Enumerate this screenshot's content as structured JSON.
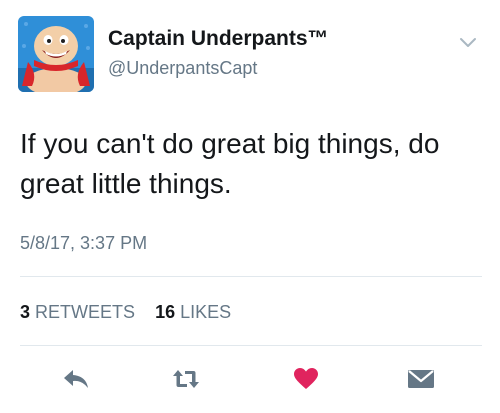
{
  "user": {
    "name": "Captain Underpants™",
    "handle": "@UnderpantsCapt"
  },
  "tweet": {
    "text": "If you can't do great big things, do great little things.",
    "timestamp": "5/8/17, 3:37 PM"
  },
  "stats": {
    "retweets_count": "3",
    "retweets_label": "RETWEETS",
    "likes_count": "16",
    "likes_label": "LIKES"
  },
  "icons": {
    "reply": "reply-icon",
    "retweet": "retweet-icon",
    "like": "heart-icon",
    "dm": "envelope-icon",
    "menu": "chevron-down-icon"
  },
  "colors": {
    "like": "#e0245e",
    "secondary_text": "#657786",
    "icon": "#657786"
  }
}
